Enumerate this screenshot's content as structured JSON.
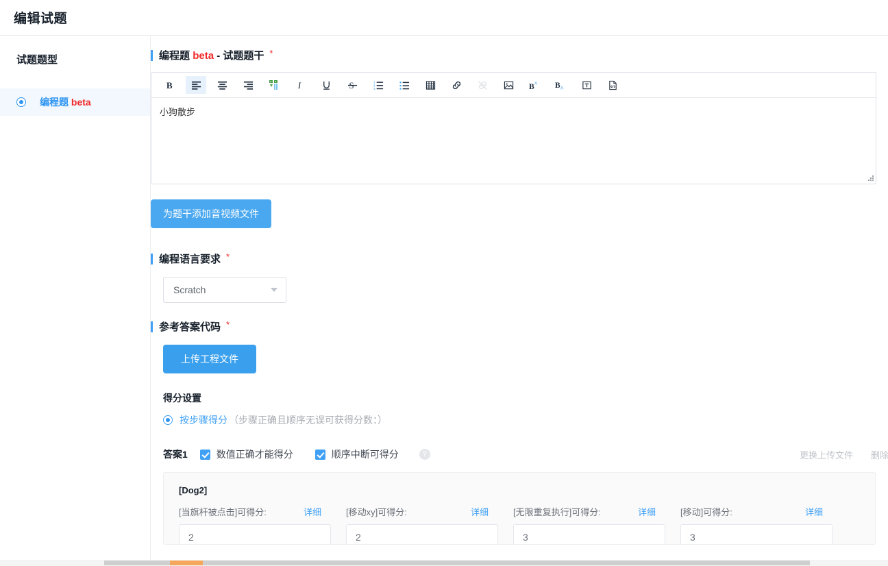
{
  "header": {
    "title": "编辑试题"
  },
  "sidebar": {
    "heading": "试题题型",
    "items": [
      {
        "label_main": "编程题",
        "label_tag": "beta",
        "selected": true,
        "name": "sidebar-item-programming"
      }
    ]
  },
  "main": {
    "stem_section": {
      "title_main": "编程题",
      "title_tag": "beta",
      "title_rest": "- 试题题干",
      "required_mark": "*",
      "editor_content": "小狗散步",
      "toolbar": [
        {
          "name": "bold-icon",
          "label": "B",
          "state": "normal"
        },
        {
          "name": "align-left-icon",
          "label": "align-left",
          "state": "active"
        },
        {
          "name": "align-center-icon",
          "label": "align-center",
          "state": "normal"
        },
        {
          "name": "align-right-icon",
          "label": "align-right",
          "state": "normal"
        },
        {
          "name": "blockquote-icon",
          "label": "blockquote",
          "state": "normal"
        },
        {
          "name": "italic-icon",
          "label": "I",
          "state": "normal"
        },
        {
          "name": "underline-icon",
          "label": "U",
          "state": "normal"
        },
        {
          "name": "strikethrough-icon",
          "label": "S",
          "state": "normal"
        },
        {
          "name": "ordered-list-icon",
          "label": "ordered-list",
          "state": "normal"
        },
        {
          "name": "unordered-list-icon",
          "label": "unordered-list",
          "state": "normal"
        },
        {
          "name": "table-icon",
          "label": "table",
          "state": "normal"
        },
        {
          "name": "link-icon",
          "label": "link",
          "state": "normal"
        },
        {
          "name": "unlink-icon",
          "label": "unlink",
          "state": "disabled"
        },
        {
          "name": "image-icon",
          "label": "image",
          "state": "normal"
        },
        {
          "name": "superscript-icon",
          "label": "superscript",
          "state": "normal"
        },
        {
          "name": "subscript-icon",
          "label": "subscript",
          "state": "normal"
        },
        {
          "name": "textbox-icon",
          "label": "textbox",
          "state": "normal"
        },
        {
          "name": "source-code-icon",
          "label": "source-code",
          "state": "normal"
        }
      ],
      "media_button": "为题干添加音视频文件"
    },
    "language_section": {
      "title": "编程语言要求",
      "required_mark": "*",
      "selected_value": "Scratch"
    },
    "answer_code_section": {
      "title": "参考答案代码",
      "required_mark": "*",
      "upload_button": "上传工程文件",
      "score_setting_title": "得分设置",
      "score_mode_label": "按步骤得分",
      "score_mode_note": "（步骤正确且顺序无误可获得分数：）"
    },
    "answer_block": {
      "title": "答案1",
      "checkboxes": [
        {
          "label": "数值正确才能得分",
          "checked": true,
          "name": "checkbox-value-correct"
        },
        {
          "label": "顺序中断可得分",
          "checked": true,
          "name": "checkbox-order-break"
        }
      ],
      "help_icon": "?",
      "actions": [
        {
          "label": "更换上传文件",
          "name": "replace-upload-link"
        },
        {
          "label": "删除",
          "name": "delete-link"
        }
      ],
      "sprite_name": "[Dog2]",
      "detail_label": "详细",
      "score_items": [
        {
          "label": "[当旗杆被点击]可得分:",
          "value": "2"
        },
        {
          "label": "[移动xy]可得分:",
          "value": "2"
        },
        {
          "label": "[无限重复执行]可得分:",
          "value": "3"
        },
        {
          "label": "[移动]可得分:",
          "value": "3"
        }
      ]
    }
  },
  "colors": {
    "accent_blue": "#3fa0f5",
    "button_blue": "#4aa8f0",
    "required_red": "#f02828",
    "muted_gray": "#bfc3c9",
    "scroll_accent": "#f5a85b"
  }
}
